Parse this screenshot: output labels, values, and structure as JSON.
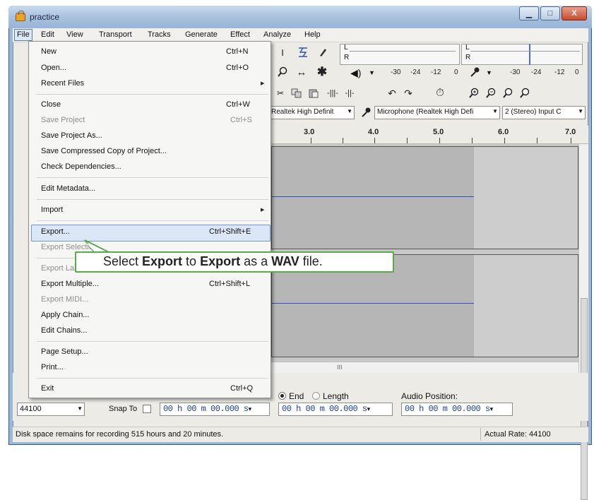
{
  "window": {
    "title": "practice",
    "minimize_glyph": "▁",
    "maximize_glyph": "□",
    "close_glyph": "X"
  },
  "menubar": {
    "items": [
      "File",
      "Edit",
      "View",
      "Transport",
      "Tracks",
      "Generate",
      "Effect",
      "Analyze",
      "Help"
    ]
  },
  "file_menu": {
    "new": {
      "label": "New",
      "shortcut": "Ctrl+N"
    },
    "open": {
      "label": "Open...",
      "shortcut": "Ctrl+O"
    },
    "recent_files": {
      "label": "Recent Files"
    },
    "close": {
      "label": "Close",
      "shortcut": "Ctrl+W"
    },
    "save_project": {
      "label": "Save Project",
      "shortcut": "Ctrl+S"
    },
    "save_project_as": {
      "label": "Save Project As..."
    },
    "save_compressed": {
      "label": "Save Compressed Copy of Project..."
    },
    "check_dependencies": {
      "label": "Check Dependencies..."
    },
    "edit_metadata": {
      "label": "Edit Metadata..."
    },
    "import": {
      "label": "Import"
    },
    "export": {
      "label": "Export...",
      "shortcut": "Ctrl+Shift+E"
    },
    "export_selection": {
      "label": "Export Selection..."
    },
    "export_labels": {
      "label": "Export Labels..."
    },
    "export_multiple": {
      "label": "Export Multiple...",
      "shortcut": "Ctrl+Shift+L"
    },
    "export_midi": {
      "label": "Export MIDI..."
    },
    "apply_chain": {
      "label": "Apply Chain..."
    },
    "edit_chains": {
      "label": "Edit Chains..."
    },
    "page_setup": {
      "label": "Page Setup..."
    },
    "print": {
      "label": "Print..."
    },
    "exit": {
      "label": "Exit",
      "shortcut": "Ctrl+Q"
    }
  },
  "callout": {
    "pre": "Select ",
    "b1": "Export",
    "mid": " to ",
    "b2": "Export",
    "mid2": " as a ",
    "b3": "WAV",
    "post": " file."
  },
  "meters": {
    "record_labels": [
      "L",
      "R"
    ],
    "playback_labels": [
      "L",
      "R"
    ],
    "scale_left": [
      "-30",
      "-24",
      "-12",
      "0"
    ],
    "scale_right": [
      "-30",
      "-24",
      "-12",
      "0"
    ]
  },
  "device_toolbar": {
    "output_device": "Realtek High Definit",
    "input_device": "Microphone (Realtek High Defi",
    "channels": "2 (Stereo) Input C"
  },
  "ruler": {
    "labels": [
      "3.0",
      "4.0",
      "5.0",
      "6.0",
      "7.0"
    ]
  },
  "selection_bar": {
    "project_rate": "44100",
    "snap_to_label": "Snap To",
    "selection_start": "00 h 00 m 00.000 s",
    "end_label": "End",
    "length_label": "Length",
    "selection_end": "00 h 00 m 00.000 s",
    "audio_position_label": "Audio Position:",
    "audio_position": "00 h 00 m 00.000 s"
  },
  "status_bar": {
    "disk_space": "Disk space remains for recording 515 hours and 20 minutes.",
    "actual_rate": "Actual Rate: 44100"
  },
  "colors": {
    "highlight_border": "#6d97cf",
    "callout_border": "#5aaa4a",
    "waveform": "#2f4fd0",
    "meter_accent": "#4a6ee0"
  }
}
